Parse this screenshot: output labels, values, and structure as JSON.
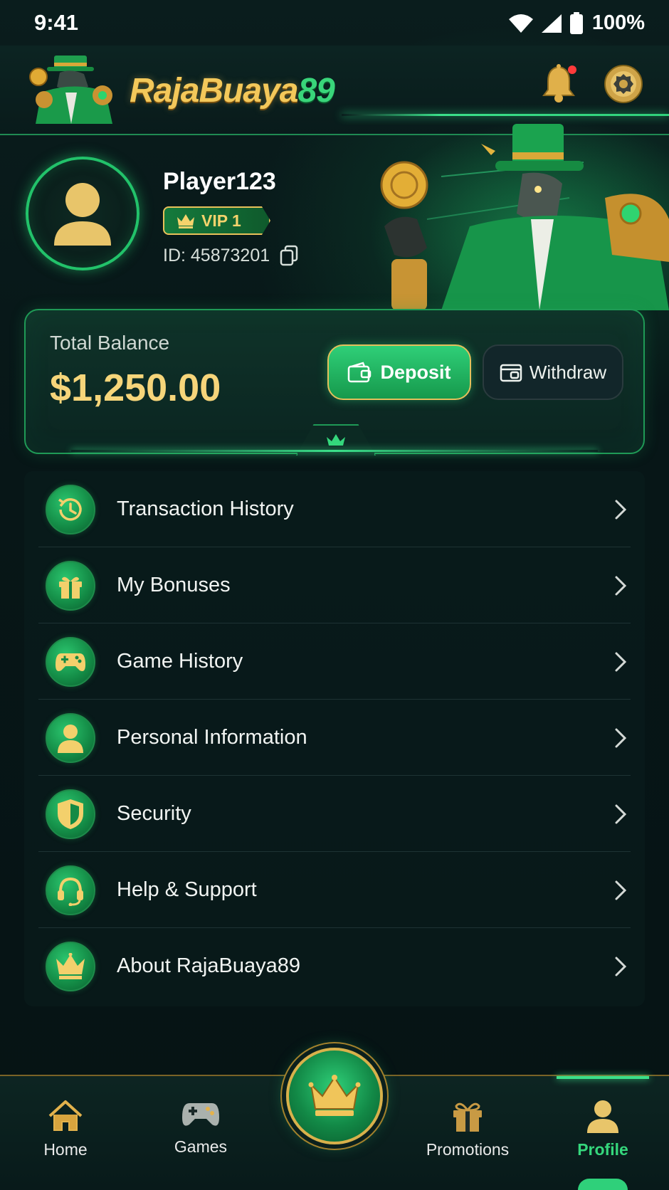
{
  "status_bar": {
    "time": "9:41",
    "battery": "100%"
  },
  "header": {
    "logo_main": "RajaBuaya",
    "logo_num": "89"
  },
  "profile": {
    "name": "Player123",
    "vip_label": "VIP 1",
    "id_text": "ID: 45873201"
  },
  "balance": {
    "label": "Total Balance",
    "amount": "$1,250.00",
    "deposit_label": "Deposit",
    "withdraw_label": "Withdraw"
  },
  "menu": {
    "items": [
      {
        "label": "Transaction History",
        "icon": "history-icon"
      },
      {
        "label": "My Bonuses",
        "icon": "gift-icon"
      },
      {
        "label": "Game History",
        "icon": "gamepad-icon"
      },
      {
        "label": "Personal Information",
        "icon": "user-icon"
      },
      {
        "label": "Security",
        "icon": "shield-icon"
      },
      {
        "label": "Help & Support",
        "icon": "headset-icon"
      },
      {
        "label": "About RajaBuaya89",
        "icon": "crown-icon"
      }
    ]
  },
  "bottom_nav": {
    "items": [
      {
        "label": "Home",
        "icon": "home-icon"
      },
      {
        "label": "Games",
        "icon": "gamepad-icon"
      },
      {
        "label": "Promotions",
        "icon": "gift-icon"
      },
      {
        "label": "Profile",
        "icon": "user-icon",
        "active": true
      }
    ],
    "center_icon": "crown-icon"
  },
  "colors": {
    "accent_green": "#35d77c",
    "gold": "#f3c85a",
    "background": "#07191a"
  }
}
